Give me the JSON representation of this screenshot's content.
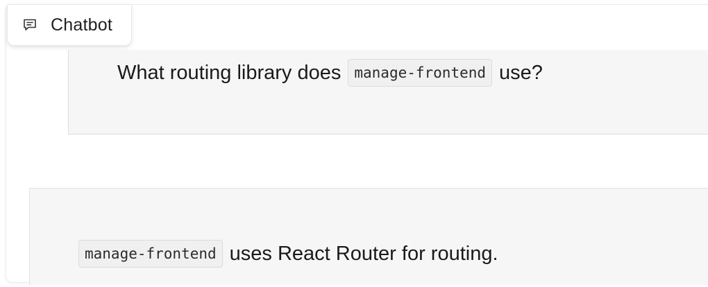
{
  "chatbot": {
    "title": "Chatbot",
    "icon": "chat-bubble-icon"
  },
  "messages": [
    {
      "role": "user",
      "text_before": "What routing library does",
      "code": "manage-frontend",
      "text_after": "use?"
    },
    {
      "role": "bot",
      "code": "manage-frontend",
      "text_after": "uses React Router for routing."
    }
  ]
}
